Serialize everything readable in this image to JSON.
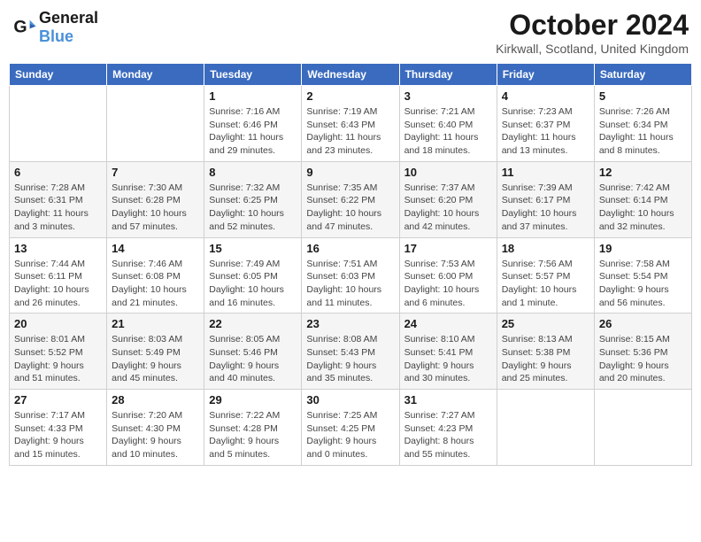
{
  "header": {
    "logo_general": "General",
    "logo_blue": "Blue",
    "month": "October 2024",
    "location": "Kirkwall, Scotland, United Kingdom"
  },
  "days_of_week": [
    "Sunday",
    "Monday",
    "Tuesday",
    "Wednesday",
    "Thursday",
    "Friday",
    "Saturday"
  ],
  "weeks": [
    [
      {
        "day": "",
        "info": ""
      },
      {
        "day": "",
        "info": ""
      },
      {
        "day": "1",
        "info": "Sunrise: 7:16 AM\nSunset: 6:46 PM\nDaylight: 11 hours\nand 29 minutes."
      },
      {
        "day": "2",
        "info": "Sunrise: 7:19 AM\nSunset: 6:43 PM\nDaylight: 11 hours\nand 23 minutes."
      },
      {
        "day": "3",
        "info": "Sunrise: 7:21 AM\nSunset: 6:40 PM\nDaylight: 11 hours\nand 18 minutes."
      },
      {
        "day": "4",
        "info": "Sunrise: 7:23 AM\nSunset: 6:37 PM\nDaylight: 11 hours\nand 13 minutes."
      },
      {
        "day": "5",
        "info": "Sunrise: 7:26 AM\nSunset: 6:34 PM\nDaylight: 11 hours\nand 8 minutes."
      }
    ],
    [
      {
        "day": "6",
        "info": "Sunrise: 7:28 AM\nSunset: 6:31 PM\nDaylight: 11 hours\nand 3 minutes."
      },
      {
        "day": "7",
        "info": "Sunrise: 7:30 AM\nSunset: 6:28 PM\nDaylight: 10 hours\nand 57 minutes."
      },
      {
        "day": "8",
        "info": "Sunrise: 7:32 AM\nSunset: 6:25 PM\nDaylight: 10 hours\nand 52 minutes."
      },
      {
        "day": "9",
        "info": "Sunrise: 7:35 AM\nSunset: 6:22 PM\nDaylight: 10 hours\nand 47 minutes."
      },
      {
        "day": "10",
        "info": "Sunrise: 7:37 AM\nSunset: 6:20 PM\nDaylight: 10 hours\nand 42 minutes."
      },
      {
        "day": "11",
        "info": "Sunrise: 7:39 AM\nSunset: 6:17 PM\nDaylight: 10 hours\nand 37 minutes."
      },
      {
        "day": "12",
        "info": "Sunrise: 7:42 AM\nSunset: 6:14 PM\nDaylight: 10 hours\nand 32 minutes."
      }
    ],
    [
      {
        "day": "13",
        "info": "Sunrise: 7:44 AM\nSunset: 6:11 PM\nDaylight: 10 hours\nand 26 minutes."
      },
      {
        "day": "14",
        "info": "Sunrise: 7:46 AM\nSunset: 6:08 PM\nDaylight: 10 hours\nand 21 minutes."
      },
      {
        "day": "15",
        "info": "Sunrise: 7:49 AM\nSunset: 6:05 PM\nDaylight: 10 hours\nand 16 minutes."
      },
      {
        "day": "16",
        "info": "Sunrise: 7:51 AM\nSunset: 6:03 PM\nDaylight: 10 hours\nand 11 minutes."
      },
      {
        "day": "17",
        "info": "Sunrise: 7:53 AM\nSunset: 6:00 PM\nDaylight: 10 hours\nand 6 minutes."
      },
      {
        "day": "18",
        "info": "Sunrise: 7:56 AM\nSunset: 5:57 PM\nDaylight: 10 hours\nand 1 minute."
      },
      {
        "day": "19",
        "info": "Sunrise: 7:58 AM\nSunset: 5:54 PM\nDaylight: 9 hours\nand 56 minutes."
      }
    ],
    [
      {
        "day": "20",
        "info": "Sunrise: 8:01 AM\nSunset: 5:52 PM\nDaylight: 9 hours\nand 51 minutes."
      },
      {
        "day": "21",
        "info": "Sunrise: 8:03 AM\nSunset: 5:49 PM\nDaylight: 9 hours\nand 45 minutes."
      },
      {
        "day": "22",
        "info": "Sunrise: 8:05 AM\nSunset: 5:46 PM\nDaylight: 9 hours\nand 40 minutes."
      },
      {
        "day": "23",
        "info": "Sunrise: 8:08 AM\nSunset: 5:43 PM\nDaylight: 9 hours\nand 35 minutes."
      },
      {
        "day": "24",
        "info": "Sunrise: 8:10 AM\nSunset: 5:41 PM\nDaylight: 9 hours\nand 30 minutes."
      },
      {
        "day": "25",
        "info": "Sunrise: 8:13 AM\nSunset: 5:38 PM\nDaylight: 9 hours\nand 25 minutes."
      },
      {
        "day": "26",
        "info": "Sunrise: 8:15 AM\nSunset: 5:36 PM\nDaylight: 9 hours\nand 20 minutes."
      }
    ],
    [
      {
        "day": "27",
        "info": "Sunrise: 7:17 AM\nSunset: 4:33 PM\nDaylight: 9 hours\nand 15 minutes."
      },
      {
        "day": "28",
        "info": "Sunrise: 7:20 AM\nSunset: 4:30 PM\nDaylight: 9 hours\nand 10 minutes."
      },
      {
        "day": "29",
        "info": "Sunrise: 7:22 AM\nSunset: 4:28 PM\nDaylight: 9 hours\nand 5 minutes."
      },
      {
        "day": "30",
        "info": "Sunrise: 7:25 AM\nSunset: 4:25 PM\nDaylight: 9 hours\nand 0 minutes."
      },
      {
        "day": "31",
        "info": "Sunrise: 7:27 AM\nSunset: 4:23 PM\nDaylight: 8 hours\nand 55 minutes."
      },
      {
        "day": "",
        "info": ""
      },
      {
        "day": "",
        "info": ""
      }
    ]
  ]
}
